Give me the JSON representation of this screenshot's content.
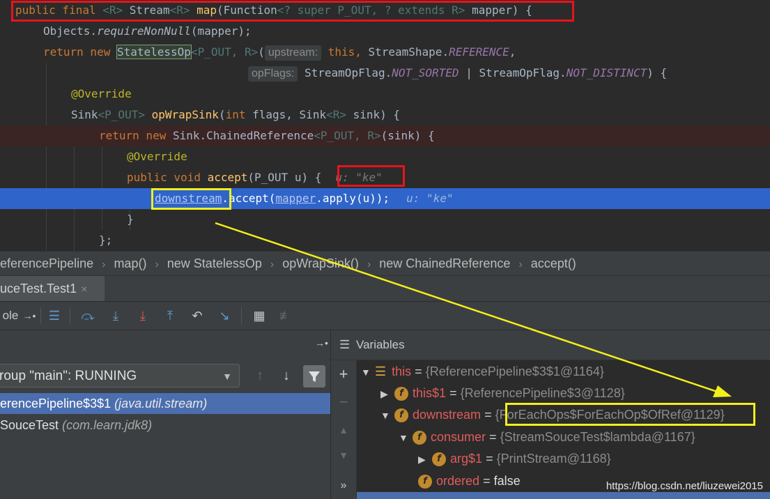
{
  "editor": {
    "line1": {
      "kw1": "public final ",
      "g1": "<R>",
      "t1": " Stream",
      "g2": "<R>",
      "fn": " map",
      "t2": "(Function",
      "g3": "<? super P_OUT, ? extends R>",
      "t3": " mapper) {"
    },
    "line2": {
      "t1": "Objects.",
      "m": "requireNonNull",
      "t2": "(mapper);"
    },
    "line3": {
      "kw": "return new ",
      "cls": "StatelessOp",
      "g": "<P_OUT, R>",
      "t1": "(",
      "hint": "upstream:",
      "t2": " this,",
      "t3": " StreamShape.",
      "c": "REFERENCE",
      "t4": ","
    },
    "line4": {
      "hint": "opFlags:",
      "t1": " StreamOpFlag.",
      "c1": "NOT_SORTED",
      "t2": " | StreamOpFlag.",
      "c2": "NOT_DISTINCT",
      "t3": ") {"
    },
    "line5": {
      "ann": "@Override"
    },
    "line6": {
      "t1": "Sink",
      "g1": "<P_OUT>",
      "fn": " opWrapSink",
      "t2": "(",
      "kw": "int",
      "t3": " flags, Sink",
      "g2": "<R>",
      "t4": " sink) {"
    },
    "line7": {
      "kw": "return new ",
      "t1": "Sink.ChainedReference",
      "g": "<P_OUT, R>",
      "t2": "(sink) {"
    },
    "line8": {
      "ann": "@Override"
    },
    "line9": {
      "kw": "public void ",
      "fn": "accept",
      "t1": "(P_OUT u) {",
      "ival": "u: \"ke\""
    },
    "line10": {
      "f1": "downstream",
      "t1": ".accept(",
      "f2": "mapper",
      "t2": ".apply(u));",
      "ival": "u: \"ke\""
    },
    "line11": {
      "t": "}"
    },
    "line12": {
      "t": "};"
    }
  },
  "breadcrumb": [
    "eferencePipeline",
    "map()",
    "new StatelessOp",
    "opWrapSink()",
    "new ChainedReference",
    "accept()"
  ],
  "debug_tab": {
    "label": "uceTest.Test1",
    "close": "×"
  },
  "toolbar": {
    "console_label": "ole"
  },
  "frames": {
    "thread": "roup \"main\": RUNNING",
    "items": [
      {
        "method": "erencePipeline$3$1",
        "pkg": "(java.util.stream)"
      },
      {
        "method": "SouceTest",
        "pkg": "(com.learn.jdk8)"
      }
    ]
  },
  "variables": {
    "title": "Variables",
    "rows": [
      {
        "name": "this",
        "value": "{ReferencePipeline$3$1@1164}"
      },
      {
        "name": "this$1",
        "value": "{ReferencePipeline$3@1128}"
      },
      {
        "name": "downstream",
        "value": "{ForEachOps$ForEachOp$OfRef@1129}"
      },
      {
        "name": "consumer",
        "value": "{StreamSouceTest$lambda@1167}"
      },
      {
        "name": "arg$1",
        "value": "{PrintStream@1168}"
      },
      {
        "name": "ordered",
        "value": "false"
      }
    ],
    "eq": "="
  },
  "watermark": "https://blog.csdn.net/liuzewei2015",
  "colors": {
    "annotation_red": "#e8141b",
    "annotation_yellow": "#f2ef1c",
    "selection_blue": "#2f65ca"
  }
}
